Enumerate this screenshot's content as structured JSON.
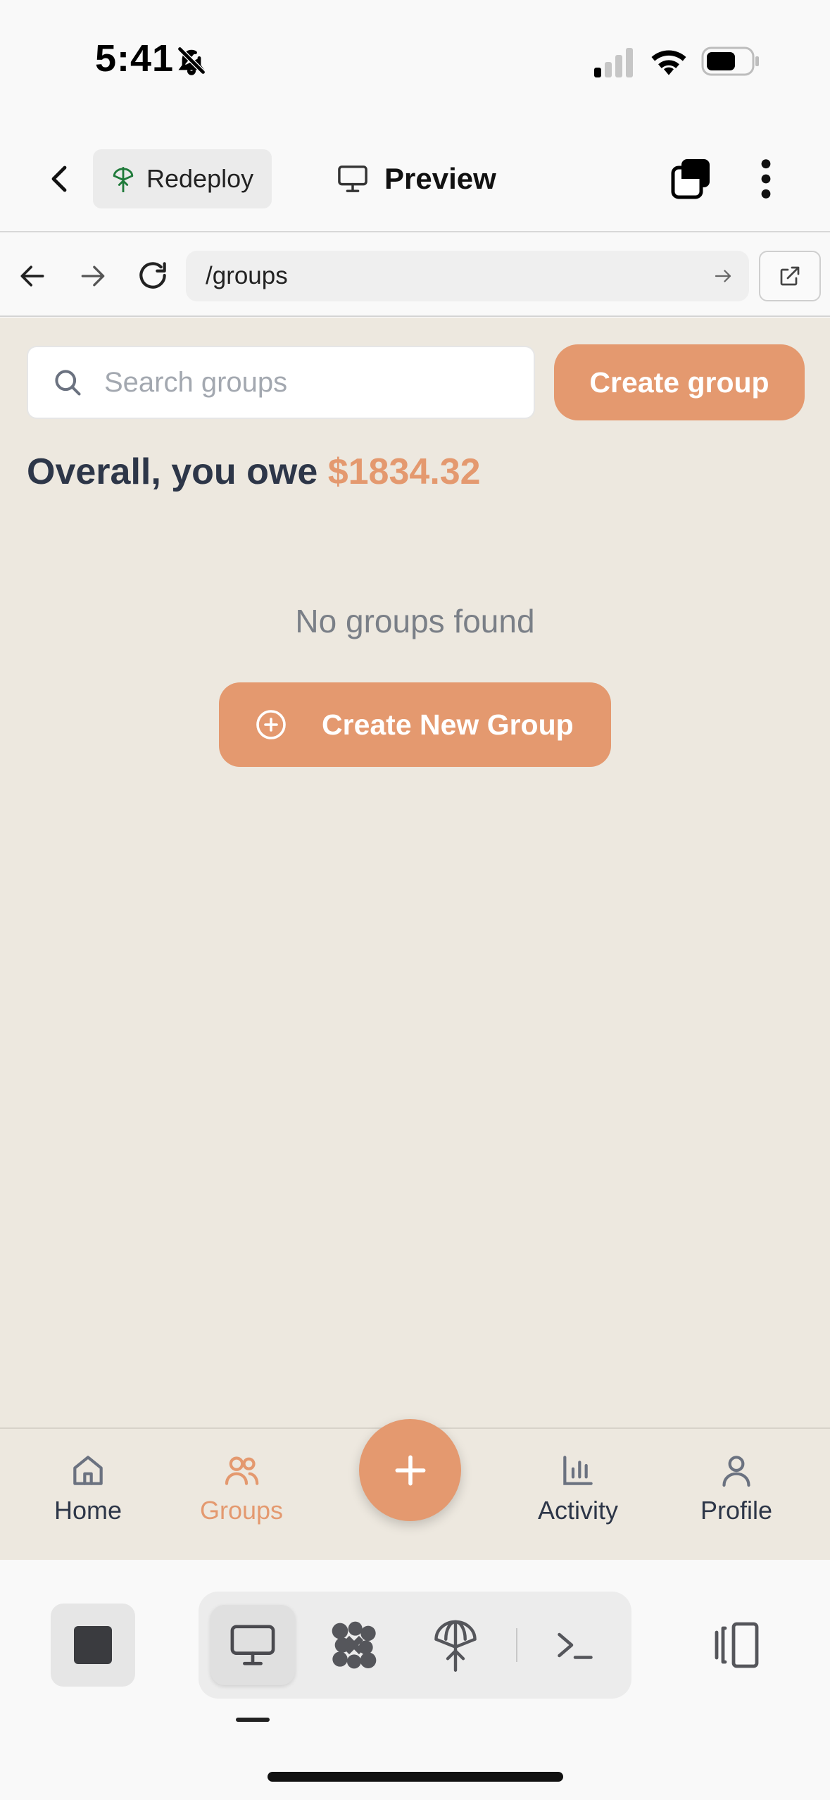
{
  "status_bar": {
    "time": "5:41"
  },
  "header": {
    "deploy_label": "Redeploy",
    "title": "Preview"
  },
  "url_bar": {
    "path": "/groups"
  },
  "main": {
    "search_placeholder": "Search groups",
    "create_group_label": "Create group",
    "owe_prefix": "Overall, you owe",
    "owe_amount": "$1834.32",
    "empty_message": "No groups found",
    "create_new_group_label": "Create New Group"
  },
  "tabs": [
    {
      "label": "Home",
      "active": false
    },
    {
      "label": "Groups",
      "active": true
    },
    {
      "label": "Activity",
      "active": false
    },
    {
      "label": "Profile",
      "active": false
    }
  ],
  "colors": {
    "accent": "#e4996f",
    "content_background": "#ede8df",
    "heading_text": "#2d3648",
    "muted_text": "#7a7f87"
  },
  "icons": {
    "header": [
      "back-chevron-icon",
      "deploy-tree-icon",
      "monitor-icon",
      "windows-icon",
      "more-vertical-icon"
    ],
    "url_bar": [
      "back-arrow-icon",
      "forward-arrow-icon",
      "reload-icon",
      "go-arrow-icon",
      "open-external-icon"
    ],
    "toolbar": [
      "stop-icon",
      "monitor-icon",
      "grid-dots-icon",
      "antenna-icon",
      "terminal-icon",
      "device-icon"
    ]
  }
}
